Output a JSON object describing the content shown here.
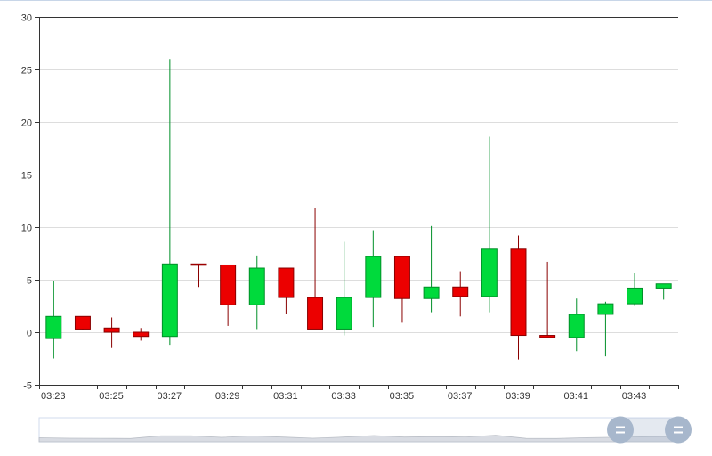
{
  "chart_data": {
    "type": "candlestick",
    "title": "",
    "xlabel": "",
    "ylabel": "",
    "ylim": [
      -5,
      30
    ],
    "y_ticks": [
      "30",
      "25",
      "20",
      "15",
      "10",
      "5",
      "0",
      "-5"
    ],
    "x_tick_labels": [
      "03:23",
      "03:25",
      "03:27",
      "03:29",
      "03:31",
      "03:33",
      "03:35",
      "03:37",
      "03:39",
      "03:41",
      "03:43"
    ],
    "categories": [
      "03:23",
      "03:24",
      "03:25",
      "03:26",
      "03:27",
      "03:28",
      "03:29",
      "03:30",
      "03:31",
      "03:32",
      "03:33",
      "03:34",
      "03:35",
      "03:36",
      "03:37",
      "03:38",
      "03:39",
      "03:40",
      "03:41",
      "03:42",
      "03:43",
      "03:44"
    ],
    "candles": [
      {
        "open": -0.6,
        "close": 1.5,
        "low": -2.5,
        "high": 4.9
      },
      {
        "open": 1.5,
        "close": 0.3,
        "low": 0.2,
        "high": 1.5
      },
      {
        "open": 0.4,
        "close": 0.0,
        "low": -1.5,
        "high": 1.4
      },
      {
        "open": 0.0,
        "close": -0.4,
        "low": -0.8,
        "high": 0.4
      },
      {
        "open": -0.4,
        "close": 6.5,
        "low": -1.2,
        "high": 26.0
      },
      {
        "open": 6.5,
        "close": 6.4,
        "low": 4.3,
        "high": 6.5
      },
      {
        "open": 6.4,
        "close": 2.6,
        "low": 0.6,
        "high": 6.4
      },
      {
        "open": 2.6,
        "close": 6.1,
        "low": 0.3,
        "high": 7.3
      },
      {
        "open": 6.1,
        "close": 3.3,
        "low": 1.7,
        "high": 6.1
      },
      {
        "open": 3.3,
        "close": 0.3,
        "low": 0.3,
        "high": 11.8
      },
      {
        "open": 0.3,
        "close": 3.3,
        "low": -0.3,
        "high": 8.6
      },
      {
        "open": 3.3,
        "close": 7.2,
        "low": 0.5,
        "high": 9.7
      },
      {
        "open": 7.2,
        "close": 3.2,
        "low": 0.9,
        "high": 7.2
      },
      {
        "open": 3.2,
        "close": 4.3,
        "low": 1.9,
        "high": 10.1
      },
      {
        "open": 4.3,
        "close": 3.4,
        "low": 1.5,
        "high": 5.8
      },
      {
        "open": 3.4,
        "close": 7.9,
        "low": 1.9,
        "high": 18.6
      },
      {
        "open": 7.9,
        "close": -0.3,
        "low": -2.6,
        "high": 9.2
      },
      {
        "open": -0.3,
        "close": -0.5,
        "low": -0.5,
        "high": 6.7
      },
      {
        "open": -0.5,
        "close": 1.7,
        "low": -1.8,
        "high": 3.2
      },
      {
        "open": 1.7,
        "close": 2.7,
        "low": -2.3,
        "high": 2.9
      },
      {
        "open": 2.7,
        "close": 4.2,
        "low": 2.5,
        "high": 5.6
      },
      {
        "open": 4.2,
        "close": 4.6,
        "low": 3.1,
        "high": 4.6
      }
    ],
    "colors": {
      "up": "#00da3c",
      "down": "#ec0000",
      "up_border": "#008f28",
      "down_border": "#8a0000",
      "grid": "#dddddd",
      "axis": "#333333"
    },
    "grid": true,
    "data_zoom": {
      "present": true,
      "range_percent": [
        0,
        100
      ]
    }
  }
}
